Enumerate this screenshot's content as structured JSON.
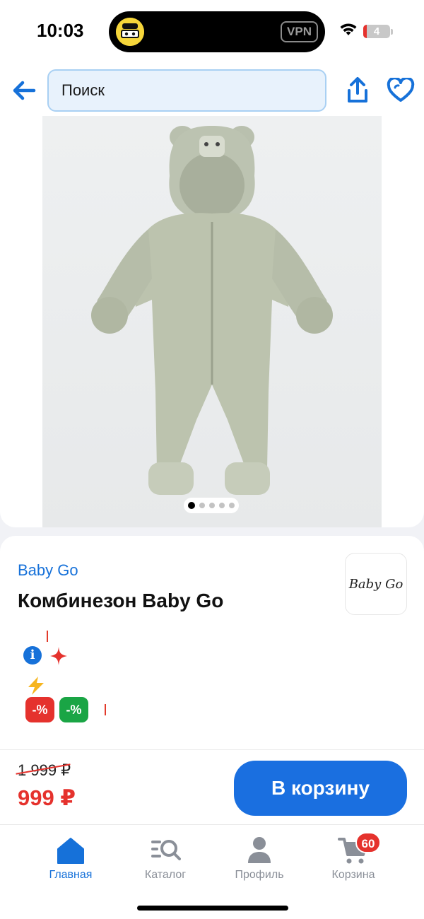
{
  "status_bar": {
    "time": "10:03",
    "vpn": "VPN",
    "battery_level": "4",
    "battery_fraction": 0.04,
    "avatar_icon": "tenyk-avatar-icon"
  },
  "topnav": {
    "search_placeholder": "Поиск",
    "back_icon": "arrow-left-icon",
    "share_icon": "share-icon",
    "favorite_icon": "heart-icon"
  },
  "gallery": {
    "image_subject": "product-photo",
    "total_images": 5,
    "active_index": 0
  },
  "product": {
    "brand": "Baby Go",
    "title": "Комбинезон Baby Go",
    "brand_logo_text": "Baby Go",
    "badge_discount_red": "-%",
    "badge_discount_green": "-%"
  },
  "pricing": {
    "old_price": "1 999 ₽",
    "new_price": "999 ₽",
    "add_to_cart_label": "В корзину"
  },
  "tabbar": {
    "tabs": [
      {
        "label": "Главная",
        "icon": "home-icon"
      },
      {
        "label": "Каталог",
        "icon": "catalog-search-icon"
      },
      {
        "label": "Профиль",
        "icon": "profile-icon"
      },
      {
        "label": "Корзина",
        "icon": "cart-icon"
      }
    ],
    "cart_count": "60"
  },
  "colors": {
    "accent": "#1671d9",
    "cta": "#1a6fe0",
    "price_red": "#e5322d",
    "badge_green": "#1aa545"
  }
}
